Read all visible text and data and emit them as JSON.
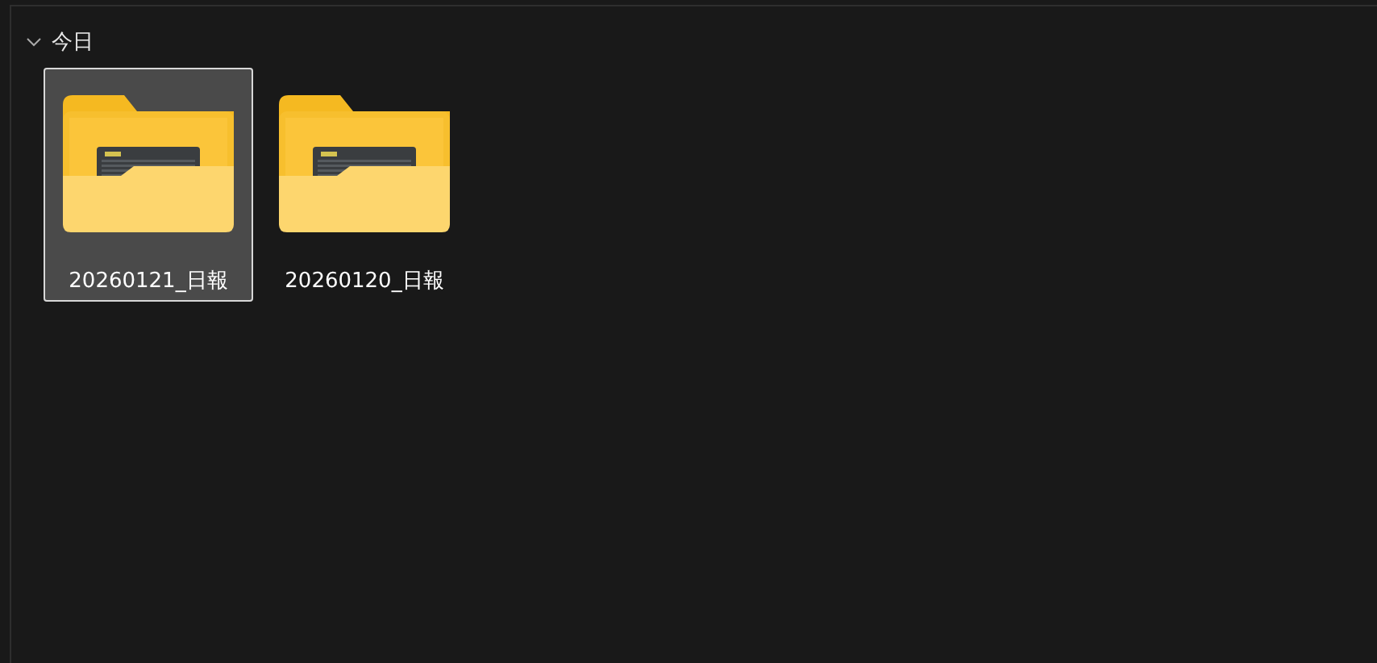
{
  "group": {
    "label": "今日",
    "expanded": true
  },
  "items": [
    {
      "name": "20260121_日報",
      "selected": true
    },
    {
      "name": "20260120_日報",
      "selected": false
    }
  ]
}
